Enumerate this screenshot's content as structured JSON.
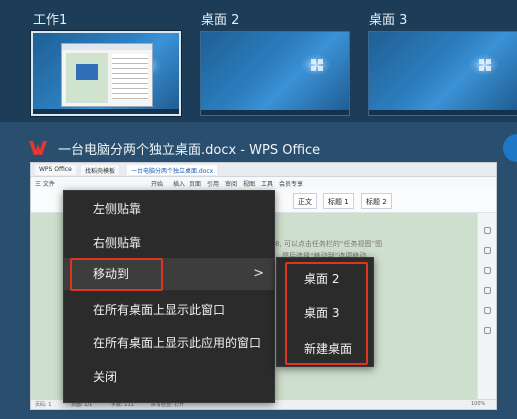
{
  "desktops": [
    {
      "label": "工作1",
      "active": true
    },
    {
      "label": "桌面 2",
      "active": false
    },
    {
      "label": "桌面 3",
      "active": false
    }
  ],
  "window": {
    "app_icon": "wps-logo-icon",
    "title": "一台电脑分两个独立桌面.docx - WPS Office"
  },
  "preview": {
    "tabs": [
      "WPS Office",
      "找稻壳模板",
      "一台电脑分两个独立桌面.docx"
    ],
    "menu": [
      "三 文件",
      "开始",
      "插入",
      "页面",
      "引用",
      "审阅",
      "视图",
      "工具",
      "会员专享"
    ],
    "styles": [
      "正文",
      "标题 1",
      "标题 2"
    ],
    "doc_lines": [
      "8, 可以点击任务栏的“任务视图”图",
      "，然后选择“移动到”选项移动"
    ],
    "status": [
      "页码: 1",
      "页面: 1/1",
      "字数: 111",
      "拼写检查: 打开",
      "100%"
    ]
  },
  "context_menu": {
    "items": [
      {
        "label": "左侧贴靠"
      },
      {
        "label": "右侧贴靠"
      },
      {
        "label": "移动到",
        "submenu": true
      },
      {
        "label": "在所有桌面上显示此窗口"
      },
      {
        "label": "在所有桌面上显示此应用的窗口"
      },
      {
        "label": "关闭"
      }
    ],
    "submenu_arrow": ">"
  },
  "submenu": {
    "items": [
      {
        "label": "桌面 2"
      },
      {
        "label": "桌面 3"
      },
      {
        "label": "新建桌面"
      }
    ]
  },
  "colors": {
    "highlight_box": "#e0341f",
    "menu_bg": "#2b2b2b",
    "strip_bg": "#1d3c58",
    "page_bg": "#2a4f6e"
  }
}
